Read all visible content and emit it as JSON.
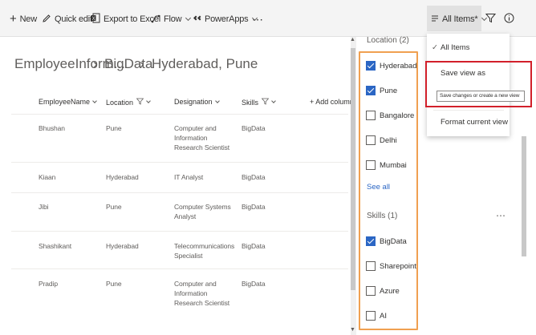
{
  "toolbar": {
    "new": "New",
    "quick_edit": "Quick edit",
    "export": "Export to Excel",
    "flow": "Flow",
    "powerapps": "PowerApps",
    "more": "⋯",
    "view": "All Items*",
    "filter_icon": "filter-icon",
    "info_icon": "info-icon"
  },
  "breadcrumb": [
    "EmployeeInform...",
    "BigData",
    "Hyderabad, Pune"
  ],
  "breadcrumb_separator": "›",
  "table": {
    "columns": [
      "EmployeeName",
      "Location",
      "Designation",
      "Skills"
    ],
    "add_column": "+ Add column",
    "rows": [
      {
        "name": "Bhushan",
        "location": "Pune",
        "designation": "Computer and Information Research Scientist",
        "skills": "BigData"
      },
      {
        "name": "Kiaan",
        "location": "Hyderabad",
        "designation": "IT Analyst",
        "skills": "BigData"
      },
      {
        "name": "Jibi",
        "location": "Pune",
        "designation": "Computer Systems Analyst",
        "skills": "BigData"
      },
      {
        "name": "Shashikant",
        "location": "Hyderabad",
        "designation": "Telecommunications Specialist",
        "skills": "BigData"
      },
      {
        "name": "Pradip",
        "location": "Pune",
        "designation": "Computer and Information Research Scientist",
        "skills": "BigData"
      }
    ]
  },
  "filters": {
    "location_title": "Location (2)",
    "location": [
      {
        "label": "Hyderabad",
        "checked": true
      },
      {
        "label": "Pune",
        "checked": true
      },
      {
        "label": "Bangalore",
        "checked": false
      },
      {
        "label": "Delhi",
        "checked": false
      },
      {
        "label": "Mumbai",
        "checked": false
      }
    ],
    "see_all": "See all",
    "skills_title": "Skills (1)",
    "skills": [
      {
        "label": "BigData",
        "checked": true
      },
      {
        "label": "Sharepoint",
        "checked": false
      },
      {
        "label": "Azure",
        "checked": false
      },
      {
        "label": "AI",
        "checked": false
      }
    ],
    "more": "⋯"
  },
  "view_menu": {
    "items": [
      "All Items",
      "Save view as",
      "Format current view"
    ],
    "check": "✓",
    "tooltip": "Save changes or create a new view"
  },
  "colors": {
    "accent": "#2b66c4",
    "highlight_red": "#d21f2a",
    "highlight_orange": "#f0a050"
  }
}
